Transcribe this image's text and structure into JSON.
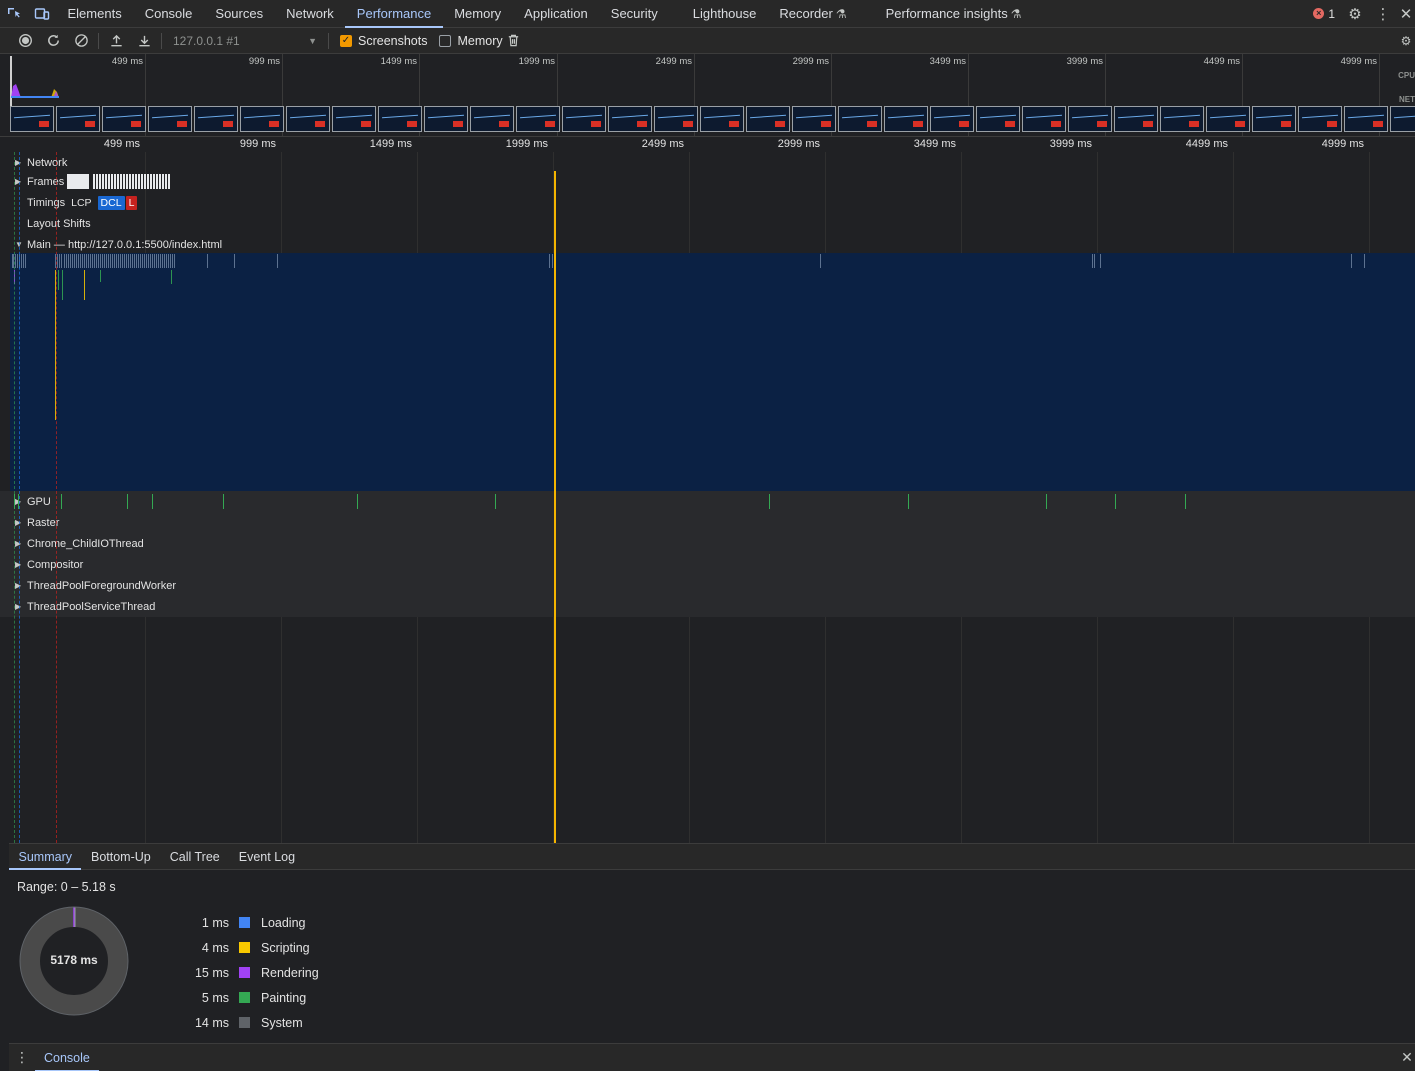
{
  "devtools": {
    "tabs": [
      "Elements",
      "Console",
      "Sources",
      "Network",
      "Performance",
      "Memory",
      "Application",
      "Security",
      "Lighthouse",
      "Recorder",
      "Performance insights"
    ],
    "active_tab": "Performance",
    "error_count": "1"
  },
  "toolbar": {
    "target": "127.0.0.1 #1",
    "screenshots_label": "Screenshots",
    "screenshots_checked": true,
    "memory_label": "Memory",
    "memory_checked": false
  },
  "overview": {
    "tick_labels": [
      "499 ms",
      "999 ms",
      "1499 ms",
      "1999 ms",
      "2499 ms",
      "2999 ms",
      "3499 ms",
      "3999 ms",
      "4499 ms",
      "4999 ms"
    ],
    "cpu_label": "CPU",
    "net_label": "NET"
  },
  "ruler": {
    "tick_labels": [
      "499 ms",
      "999 ms",
      "1499 ms",
      "1999 ms",
      "2499 ms",
      "2999 ms",
      "3499 ms",
      "3999 ms",
      "4499 ms",
      "4999 ms"
    ]
  },
  "tracks": {
    "network": "Network",
    "frames": "Frames",
    "timings": "Timings",
    "timing_marks": {
      "lcp": "LCP",
      "dcl": "DCL",
      "l": "L"
    },
    "layout_shifts": "Layout Shifts",
    "main": "Main — http://127.0.0.1:5500/index.html",
    "gpu": "GPU",
    "raster": "Raster",
    "child_io": "Chrome_ChildIOThread",
    "compositor": "Compositor",
    "fg_worker": "ThreadPoolForegroundWorker",
    "service": "ThreadPoolServiceThread"
  },
  "bottom_tabs": [
    "Summary",
    "Bottom-Up",
    "Call Tree",
    "Event Log"
  ],
  "bottom_active": "Summary",
  "summary": {
    "range": "Range: 0 – 5.18 s",
    "total": "5178 ms",
    "items": [
      {
        "value": "1 ms",
        "name": "Loading",
        "color": "#4285f4"
      },
      {
        "value": "4 ms",
        "name": "Scripting",
        "color": "#f9c900"
      },
      {
        "value": "15 ms",
        "name": "Rendering",
        "color": "#a142f4"
      },
      {
        "value": "5 ms",
        "name": "Painting",
        "color": "#34a853"
      },
      {
        "value": "14 ms",
        "name": "System",
        "color": "#5f6368"
      }
    ]
  },
  "drawer": {
    "tab": "Console"
  }
}
